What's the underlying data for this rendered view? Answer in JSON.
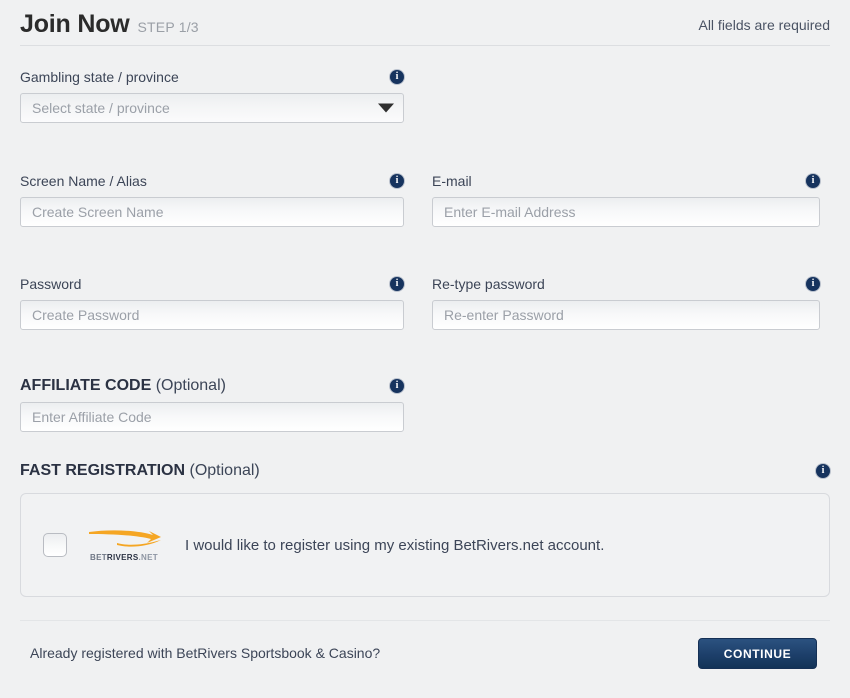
{
  "header": {
    "title": "Join Now",
    "step": "STEP 1/3",
    "required_note": "All fields are required"
  },
  "form": {
    "gambling_state": {
      "label": "Gambling state / province",
      "placeholder": "Select state / province",
      "value": "",
      "info_icon": "info-icon"
    },
    "screen_name": {
      "label": "Screen Name / Alias",
      "placeholder": "Create Screen Name",
      "value": "",
      "info_icon": "info-icon"
    },
    "email": {
      "label": "E-mail",
      "placeholder": "Enter E-mail Address",
      "value": "",
      "info_icon": "info-icon"
    },
    "password": {
      "label": "Password",
      "placeholder": "Create Password",
      "value": "",
      "info_icon": "info-icon"
    },
    "retype_password": {
      "label": "Re-type password",
      "placeholder": "Re-enter Password",
      "value": "",
      "info_icon": "info-icon"
    },
    "affiliate_code": {
      "label_main": "AFFILIATE CODE",
      "label_optional": " (Optional)",
      "placeholder": "Enter Affiliate Code",
      "value": "",
      "info_icon": "info-icon"
    },
    "fast_registration": {
      "label_main": "FAST REGISTRATION",
      "label_optional": " (Optional)",
      "info_icon": "info-icon",
      "checkbox_checked": false,
      "brand": {
        "wordmark_bet": "BET",
        "wordmark_rivers": "RIVERS",
        "wordmark_net": ".NET",
        "swoosh_color": "#f5a623"
      },
      "consent_text": "I would like to register using my existing BetRivers.net account."
    }
  },
  "footer": {
    "already_registered": "Already registered with BetRivers Sportsbook & Casino?",
    "continue_label": "CONTINUE"
  },
  "colors": {
    "page_background": "#f0f1f2",
    "accent_navy": "#16335e",
    "button_navy": "#1d3f6a",
    "brand_orange": "#f5a623",
    "text_primary": "#3c4557",
    "text_muted": "#9ba0a8"
  }
}
